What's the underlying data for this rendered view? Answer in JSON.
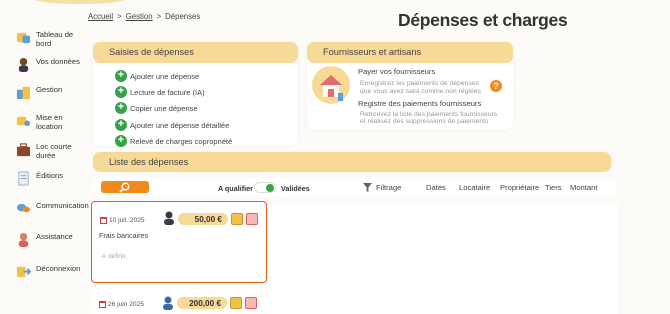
{
  "breadcrumb": {
    "home": "Accueil",
    "sep1": ">",
    "section": "Gestion",
    "sep2": ">",
    "current": "Dépenses"
  },
  "page": {
    "title": "Dépenses et charges"
  },
  "sidebar": {
    "items": [
      {
        "label": "Tableau de bord",
        "icon": "dashboard-icon"
      },
      {
        "label": "Vos données",
        "icon": "user-icon"
      },
      {
        "label": "Gestion",
        "icon": "management-icon"
      },
      {
        "label": "Mise en location",
        "icon": "rental-icon"
      },
      {
        "label": "Loc courte durée",
        "icon": "suitcase-icon"
      },
      {
        "label": "Éditions",
        "icon": "documents-icon"
      },
      {
        "label": "Communication",
        "icon": "chat-icon"
      },
      {
        "label": "Assistance",
        "icon": "support-icon"
      },
      {
        "label": "Déconnexion",
        "icon": "logout-icon"
      }
    ]
  },
  "saisies": {
    "title": "Saisies de dépenses",
    "actions": [
      "Ajouter une dépense",
      "Lecture de facture (IA)",
      "Copier une dépense",
      "Ajouter une dépense détaillée",
      "Relevé de charges copropriété"
    ]
  },
  "fournisseurs": {
    "title": "Fournisseurs et artisans",
    "pay_title": "Payer vos fournisseurs",
    "pay_desc_1": "Enregistrez les paiements de dépenses",
    "pay_desc_2": "que vous avez saisi comme non réglées",
    "help": "?",
    "reg_title": "Registre des paiements fournisseurs",
    "reg_desc_1": "Retrouvez la liste des paiements fournisseurs",
    "reg_desc_2": "et réalisez des suppressions de paiements"
  },
  "liste": {
    "title": "Liste des dépenses",
    "toggle_left": "A qualifier",
    "toggle_right": "Validées",
    "filter": "Filtrage",
    "columns": [
      "Dates",
      "Locataire",
      "Propriétaire",
      "Tiers",
      "Montant"
    ]
  },
  "entries": [
    {
      "date": "10 juil. 2025",
      "amount": "50,00 €",
      "label": "Frais bancaires",
      "placeholder": "A définir"
    },
    {
      "date": "26 juin 2025",
      "amount": "200,00 €"
    }
  ],
  "colors": {
    "accent": "#f7d998",
    "orange": "#f28a1a",
    "green": "#35a24a",
    "selection": "#e85a1a"
  }
}
